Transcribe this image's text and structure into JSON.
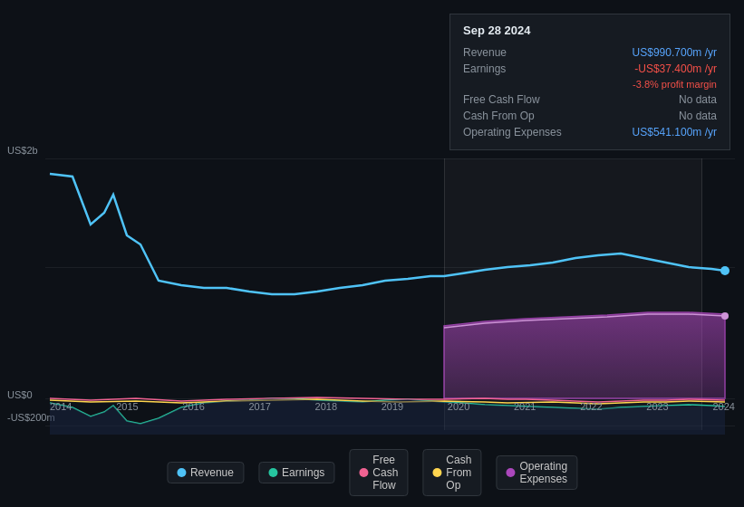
{
  "tooltip": {
    "date": "Sep 28 2024",
    "revenue_label": "Revenue",
    "revenue_value": "US$990.700m",
    "revenue_unit": "/yr",
    "earnings_label": "Earnings",
    "earnings_value": "-US$37.400m",
    "earnings_unit": "/yr",
    "profit_margin": "-3.8% profit margin",
    "fcf_label": "Free Cash Flow",
    "fcf_value": "No data",
    "cashfromop_label": "Cash From Op",
    "cashfromop_value": "No data",
    "opex_label": "Operating Expenses",
    "opex_value": "US$541.100m",
    "opex_unit": "/yr"
  },
  "chart": {
    "y_labels": [
      "US$2b",
      "US$0",
      "-US$200m"
    ],
    "x_labels": [
      "2014",
      "2015",
      "2016",
      "2017",
      "2018",
      "2019",
      "2020",
      "2021",
      "2022",
      "2023",
      "2024"
    ]
  },
  "legend": {
    "items": [
      {
        "label": "Revenue",
        "color": "#4fc3f7",
        "id": "revenue"
      },
      {
        "label": "Earnings",
        "color": "#26c6a0",
        "id": "earnings"
      },
      {
        "label": "Free Cash Flow",
        "color": "#f06292",
        "id": "fcf"
      },
      {
        "label": "Cash From Op",
        "color": "#ffd54f",
        "id": "cashfromop"
      },
      {
        "label": "Operating Expenses",
        "color": "#ab47bc",
        "id": "opex"
      }
    ]
  }
}
